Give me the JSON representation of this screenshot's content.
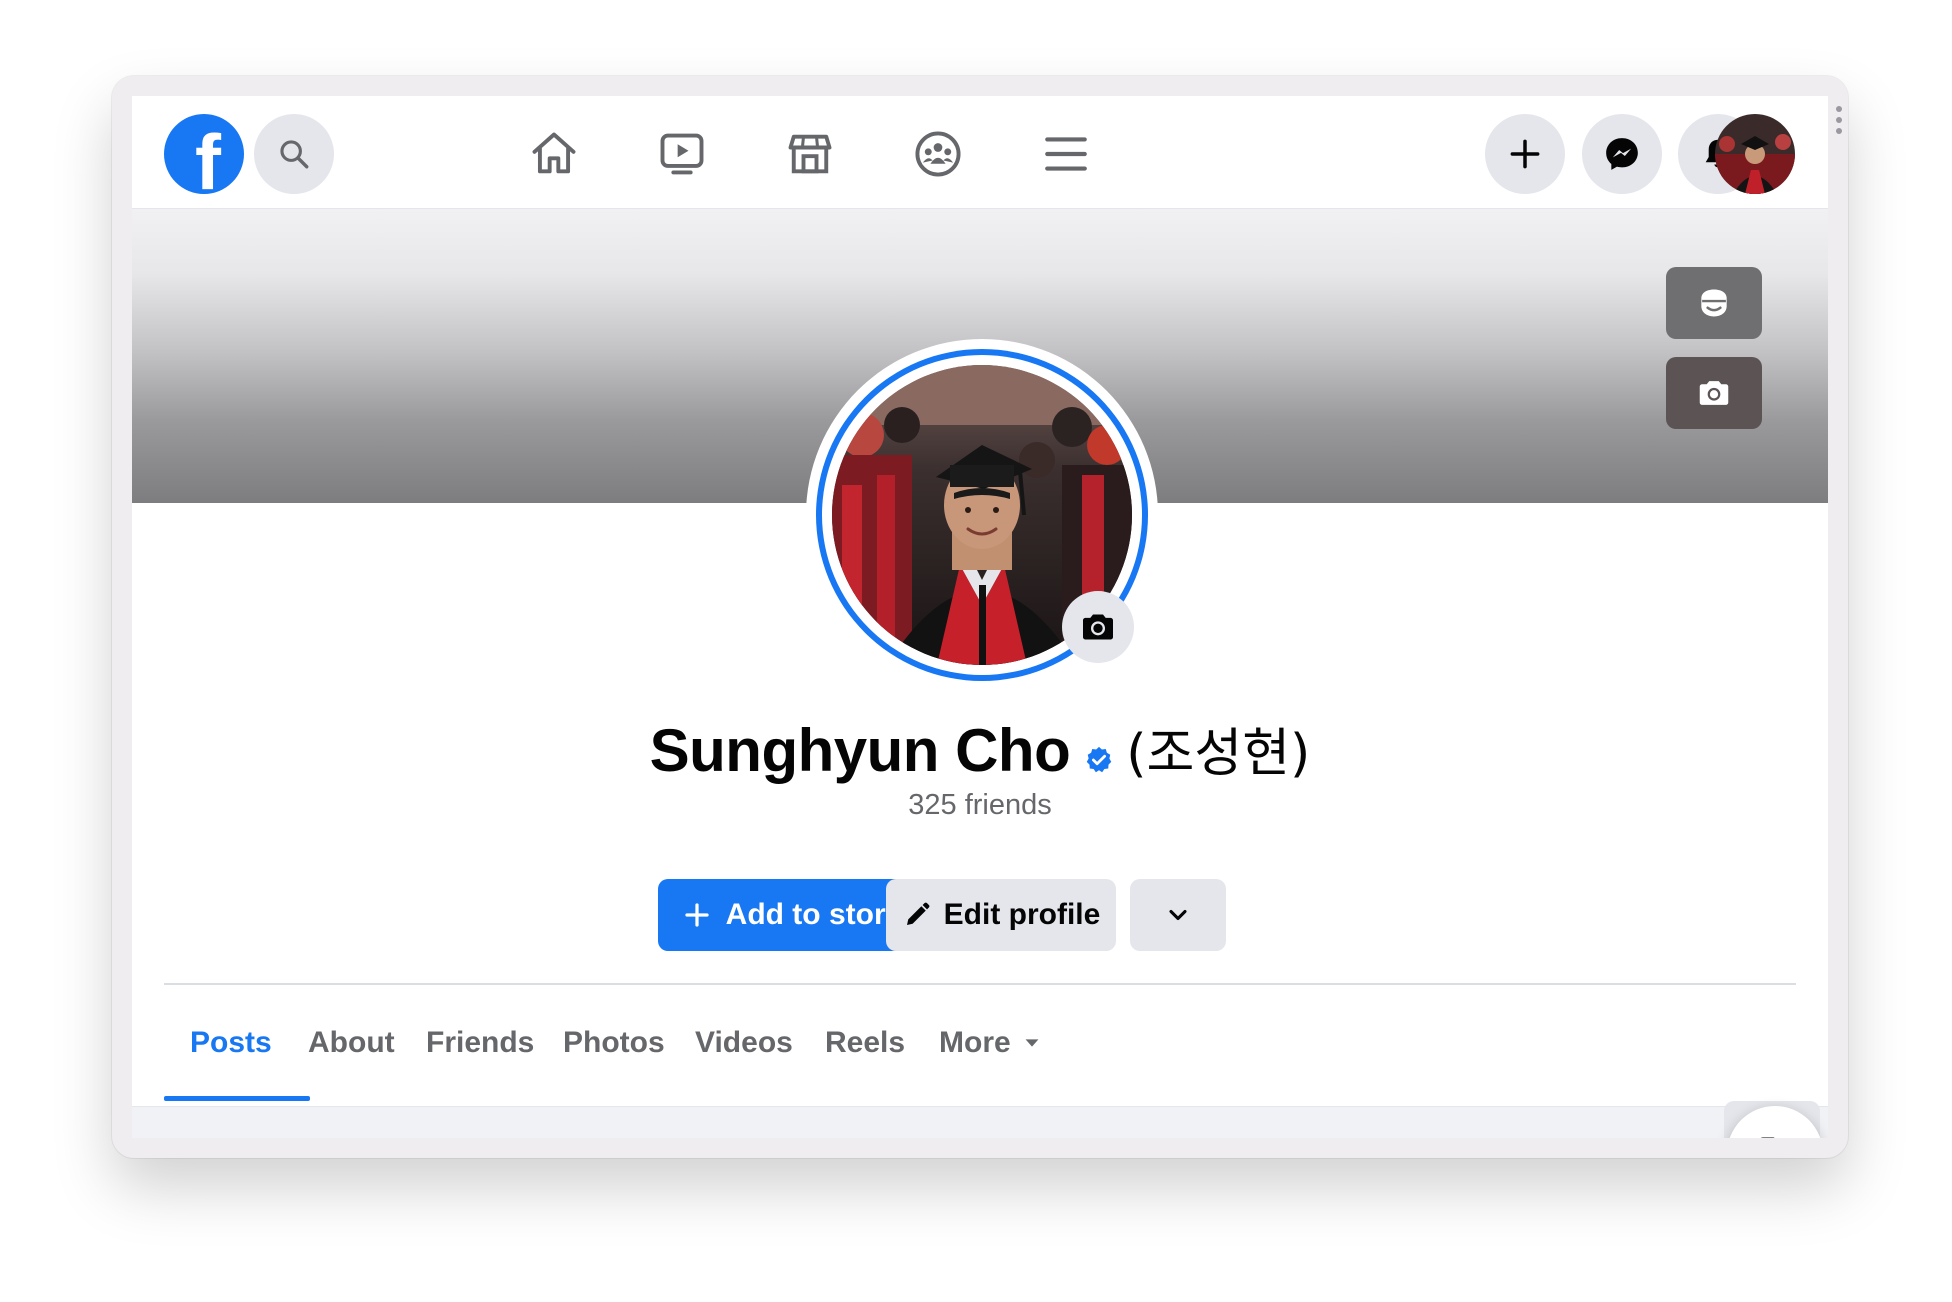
{
  "profile": {
    "name": "Sunghyun Cho",
    "name_korean": "(조성현)",
    "friends": "325 friends",
    "verified": true
  },
  "actions": {
    "add_to_story": "Add to story",
    "edit_profile": "Edit profile"
  },
  "tabs": [
    {
      "label": "Posts",
      "active": true
    },
    {
      "label": "About"
    },
    {
      "label": "Friends"
    },
    {
      "label": "Photos"
    },
    {
      "label": "Videos"
    },
    {
      "label": "Reels"
    },
    {
      "label": "More"
    }
  ],
  "colors": {
    "accent": "#1877f2",
    "button_gray": "#e4e6eb",
    "text_secondary": "#65676b"
  },
  "icons": {
    "nav": [
      "home-icon",
      "watch-icon",
      "marketplace-icon",
      "groups-icon",
      "menu-icon"
    ],
    "right": [
      "create-icon",
      "messenger-icon",
      "notifications-icon"
    ]
  }
}
